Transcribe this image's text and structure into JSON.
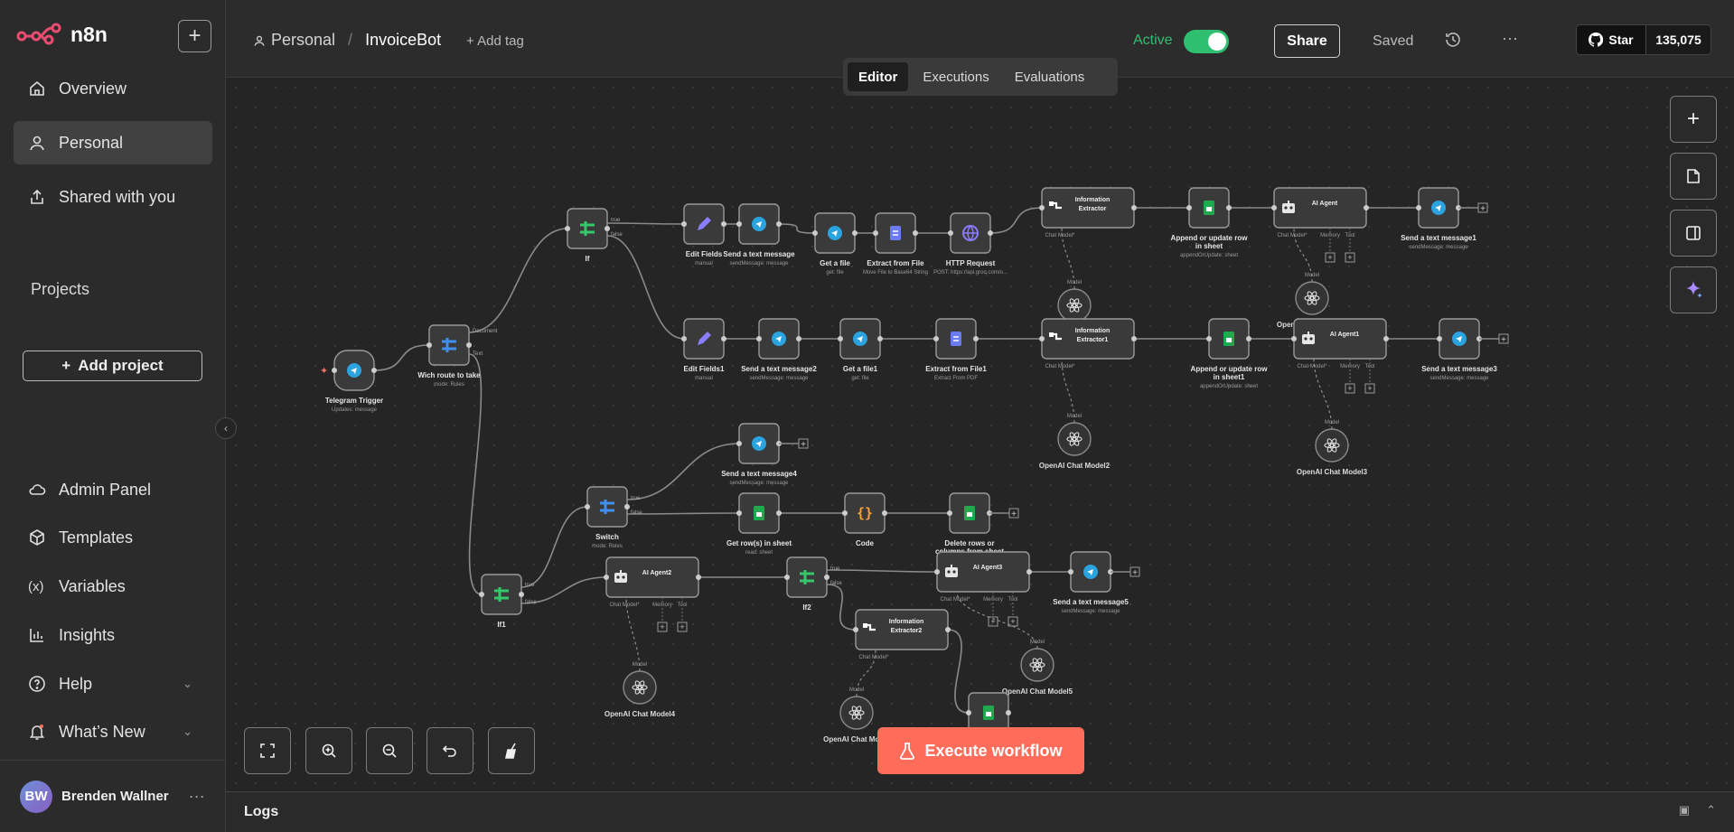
{
  "app": {
    "name": "n8n",
    "brand_color": "#ea4b71"
  },
  "sidebar": {
    "items": [
      {
        "label": "Overview",
        "icon": "home-icon"
      },
      {
        "label": "Personal",
        "icon": "user-icon"
      },
      {
        "label": "Shared with you",
        "icon": "share-icon"
      }
    ],
    "projects_heading": "Projects",
    "add_project": "Add project",
    "bottom_items": [
      {
        "label": "Admin Panel",
        "icon": "cloud-icon"
      },
      {
        "label": "Templates",
        "icon": "box-icon"
      },
      {
        "label": "Variables",
        "icon": "variable-icon"
      },
      {
        "label": "Insights",
        "icon": "chart-icon"
      },
      {
        "label": "Help",
        "icon": "help-icon"
      },
      {
        "label": "What’s New",
        "icon": "bell-icon"
      }
    ],
    "user": {
      "initials": "BW",
      "name": "Brenden Wallner"
    }
  },
  "header": {
    "breadcrumb_project": "Personal",
    "workflow_name": "InvoiceBot",
    "add_tag": "+ Add tag",
    "active_label": "Active",
    "share": "Share",
    "saved": "Saved",
    "github": {
      "star": "Star",
      "count": "135,075"
    },
    "tabs": [
      "Editor",
      "Executions",
      "Evaluations"
    ]
  },
  "colors": {
    "accent_green": "#2fbf71",
    "execute": "#ff6d5a",
    "telegram": "#2aa3df",
    "sheets": "#1faa4f"
  },
  "canvas": {
    "execute_label": "Execute workflow",
    "nodes": [
      {
        "name": "Telegram Trigger",
        "sub": "Updates: message",
        "icon": "telegram-icon"
      },
      {
        "name": "Wich route to take",
        "sub": "mode: Rules",
        "icon": "switch-icon"
      },
      {
        "name": "If",
        "sub": "",
        "icon": "if-icon"
      },
      {
        "name": "Edit Fields",
        "sub": "manual",
        "icon": "pencil-icon"
      },
      {
        "name": "Send a text message",
        "sub": "sendMessage: message",
        "icon": "telegram-icon"
      },
      {
        "name": "Get a file",
        "sub": "get: file",
        "icon": "telegram-icon"
      },
      {
        "name": "Extract from File",
        "sub": "Move File to Base64 String",
        "icon": "file-icon"
      },
      {
        "name": "HTTP Request",
        "sub": "POST: https://api.groq.com/o...",
        "icon": "globe-icon"
      },
      {
        "name": "Information Extractor",
        "sub": "",
        "icon": "extractor-icon"
      },
      {
        "name": "Append or update row in sheet",
        "sub": "appendOrUpdate: sheet",
        "icon": "sheets-icon"
      },
      {
        "name": "AI Agent",
        "sub": "",
        "icon": "robot-icon"
      },
      {
        "name": "Send a text message1",
        "sub": "sendMessage: message",
        "icon": "telegram-icon"
      },
      {
        "name": "OpenAI Chat Model",
        "sub": "",
        "icon": "openai-icon"
      },
      {
        "name": "OpenAI Chat Model1",
        "sub": "",
        "icon": "openai-icon"
      },
      {
        "name": "Edit Fields1",
        "sub": "manual",
        "icon": "pencil-icon"
      },
      {
        "name": "Send a text message2",
        "sub": "sendMessage: message",
        "icon": "telegram-icon"
      },
      {
        "name": "Get a file1",
        "sub": "get: file",
        "icon": "telegram-icon"
      },
      {
        "name": "Extract from File1",
        "sub": "Extract From PDF",
        "icon": "file-icon"
      },
      {
        "name": "Information Extractor1",
        "sub": "",
        "icon": "extractor-icon"
      },
      {
        "name": "Append or update row in sheet1",
        "sub": "appendOrUpdate: sheet",
        "icon": "sheets-icon"
      },
      {
        "name": "AI Agent1",
        "sub": "",
        "icon": "robot-icon"
      },
      {
        "name": "Send a text message3",
        "sub": "sendMessage: message",
        "icon": "telegram-icon"
      },
      {
        "name": "OpenAI Chat Model2",
        "sub": "",
        "icon": "openai-icon"
      },
      {
        "name": "OpenAI Chat Model3",
        "sub": "",
        "icon": "openai-icon"
      },
      {
        "name": "Send a text message4",
        "sub": "sendMessage: message",
        "icon": "telegram-icon"
      },
      {
        "name": "Switch",
        "sub": "mode: Rules",
        "icon": "switch-icon"
      },
      {
        "name": "Get row(s) in sheet",
        "sub": "read: sheet",
        "icon": "sheets-icon"
      },
      {
        "name": "Code",
        "sub": "",
        "icon": "code-icon"
      },
      {
        "name": "Delete rows or columns from sheet",
        "sub": "delete: sheet",
        "icon": "sheets-icon"
      },
      {
        "name": "If1",
        "sub": "",
        "icon": "if-icon"
      },
      {
        "name": "AI Agent2",
        "sub": "",
        "icon": "robot-icon"
      },
      {
        "name": "OpenAI Chat Model4",
        "sub": "",
        "icon": "openai-icon"
      },
      {
        "name": "If2",
        "sub": "",
        "icon": "if-icon"
      },
      {
        "name": "AI Agent3",
        "sub": "",
        "icon": "robot-icon"
      },
      {
        "name": "Send a text message5",
        "sub": "sendMessage: message",
        "icon": "telegram-icon"
      },
      {
        "name": "OpenAI Chat Model5",
        "sub": "",
        "icon": "openai-icon"
      },
      {
        "name": "Information Extractor2",
        "sub": "",
        "icon": "extractor-icon"
      },
      {
        "name": "OpenAI Chat Model",
        "sub": "",
        "icon": "openai-icon"
      },
      {
        "name": "",
        "sub": "",
        "icon": "sheets-icon"
      }
    ],
    "port_labels": {
      "document": "Document",
      "text": "Text",
      "true": "true",
      "false": "false",
      "model": "Model",
      "chat_model": "Chat Model*",
      "memory": "Memory",
      "tool": "Tool"
    }
  },
  "logs": {
    "label": "Logs"
  }
}
